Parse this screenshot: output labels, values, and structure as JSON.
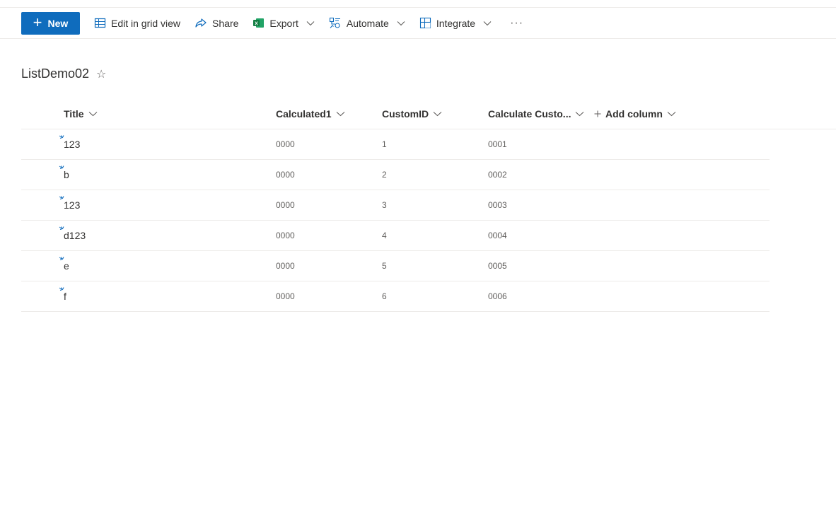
{
  "toolbar": {
    "new_label": "New",
    "edit_grid_label": "Edit in grid view",
    "share_label": "Share",
    "export_label": "Export",
    "automate_label": "Automate",
    "integrate_label": "Integrate",
    "more_label": "···"
  },
  "list": {
    "title": "ListDemo02",
    "star": "☆"
  },
  "columns": {
    "title": "Title",
    "calculated1": "Calculated1",
    "customid": "CustomID",
    "calculate_custom": "Calculate Custo...",
    "add_column": "Add column"
  },
  "rows": [
    {
      "title": "123",
      "calculated1": "0000",
      "customid": "1",
      "calculate_custom": "0001"
    },
    {
      "title": "b",
      "calculated1": "0000",
      "customid": "2",
      "calculate_custom": "0002"
    },
    {
      "title": "123",
      "calculated1": "0000",
      "customid": "3",
      "calculate_custom": "0003"
    },
    {
      "title": "d123",
      "calculated1": "0000",
      "customid": "4",
      "calculate_custom": "0004"
    },
    {
      "title": "e",
      "calculated1": "0000",
      "customid": "5",
      "calculate_custom": "0005"
    },
    {
      "title": "f",
      "calculated1": "0000",
      "customid": "6",
      "calculate_custom": "0006"
    }
  ],
  "colors": {
    "accent": "#0f6cbd",
    "excel": "#107c41",
    "divider": "#edebe9"
  }
}
